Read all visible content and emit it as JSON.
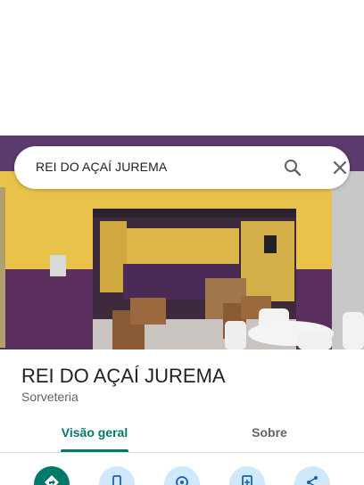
{
  "search": {
    "query": "REI DO AÇAÍ JUREMA"
  },
  "place": {
    "name": "REI DO AÇAÍ JUREMA",
    "category": "Sorveteria"
  },
  "tabs": [
    {
      "label": "Visão geral",
      "active": true
    },
    {
      "label": "Sobre",
      "active": false
    }
  ],
  "actions": [
    {
      "icon": "directions-icon",
      "primary": true
    },
    {
      "icon": "phone-icon"
    },
    {
      "icon": "location-icon"
    },
    {
      "icon": "add-document-icon"
    },
    {
      "icon": "share-icon"
    }
  ],
  "colors": {
    "accent": "#00796b",
    "action_bg": "#cfe8fc",
    "text": "#202124",
    "subtext": "#5f6368"
  }
}
